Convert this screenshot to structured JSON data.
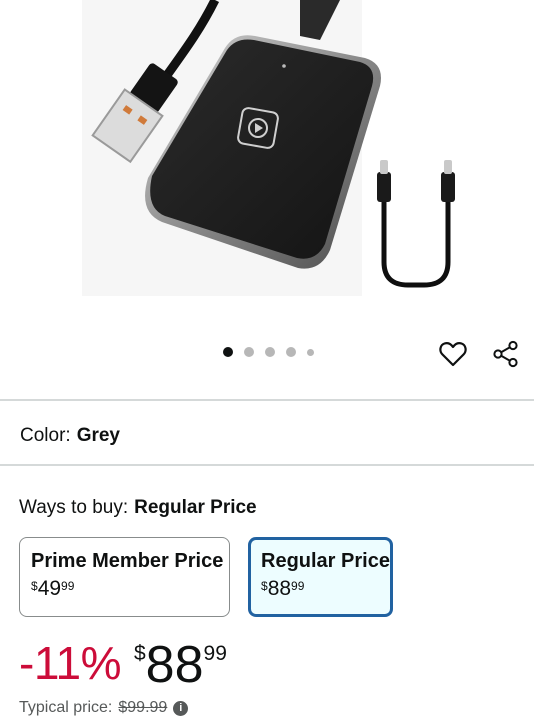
{
  "product_image": {
    "alt_name": "wireless-carplay-adapter"
  },
  "carousel": {
    "active_index": 0,
    "count": 5
  },
  "color": {
    "label": "Color:",
    "value": "Grey"
  },
  "ways_to_buy": {
    "label": "Ways to buy:",
    "value": "Regular Price"
  },
  "options": [
    {
      "title": "Prime Member Price",
      "currency": "$",
      "whole": "49",
      "fraction": "99"
    },
    {
      "title": "Regular Price",
      "currency": "$",
      "whole": "88",
      "fraction": "99",
      "selected": true
    }
  ],
  "price": {
    "discount": "-11%",
    "currency": "$",
    "whole": "88",
    "fraction": "99"
  },
  "typical": {
    "label": "Typical price:",
    "value": "$99.99"
  },
  "colors": {
    "accent_blue": "#2162a1",
    "discount_red": "#cc0c39",
    "selected_bg": "#edfdff"
  },
  "icons": {
    "wishlist": "heart-icon",
    "share": "share-icon",
    "info": "info-icon"
  }
}
